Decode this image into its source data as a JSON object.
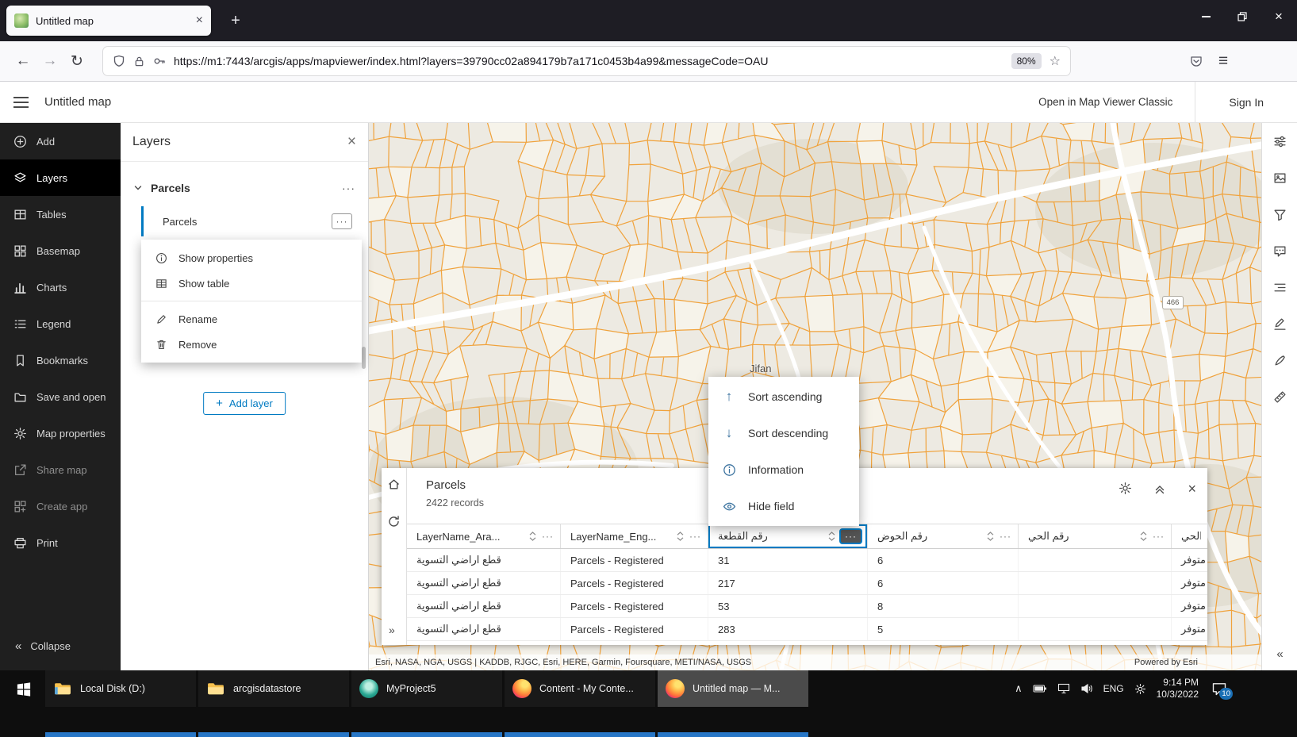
{
  "colors": {
    "accent": "#007ac2",
    "parcel_orange": "#f0a23b",
    "taskbar_indicator": "#2776c6"
  },
  "glyphs": {
    "close": "×",
    "plus": "+",
    "ellipsis": "···",
    "minimize": "–",
    "back": "←",
    "forward": "→",
    "reload": "↻",
    "star": "☆",
    "menu": "≡",
    "chevron_double_left": "«",
    "chevron_double_right": "»",
    "arrow_up": "↑",
    "arrow_down": "↓",
    "chevron_up": "∧"
  },
  "browser": {
    "tab_title": "Untitled map",
    "url": "https://m1:7443/arcgis/apps/mapviewer/index.html?layers=39790cc02a894179b7a171c0453b4a99&messageCode=OAU",
    "zoom_badge": "80%",
    "icon_names": [
      "shield-icon",
      "lock-icon",
      "key-icon",
      "star-icon",
      "pocket-icon",
      "menu-icon"
    ]
  },
  "app_header": {
    "title": "Untitled map",
    "open_classic": "Open in Map Viewer Classic",
    "sign_in": "Sign In"
  },
  "sidebar": {
    "items": [
      {
        "label": "Add",
        "icon": "add-icon"
      },
      {
        "label": "Layers",
        "icon": "layers-icon",
        "selected": true
      },
      {
        "label": "Tables",
        "icon": "tables-icon"
      },
      {
        "label": "Basemap",
        "icon": "basemap-icon"
      },
      {
        "label": "Charts",
        "icon": "charts-icon"
      },
      {
        "label": "Legend",
        "icon": "legend-icon"
      },
      {
        "label": "Bookmarks",
        "icon": "bookmark-icon"
      },
      {
        "label": "Save and open",
        "icon": "folder-icon"
      },
      {
        "label": "Map properties",
        "icon": "gear-icon"
      },
      {
        "label": "Share map",
        "icon": "share-icon",
        "disabled": true
      },
      {
        "label": "Create app",
        "icon": "create-app-icon",
        "disabled": true
      },
      {
        "label": "Print",
        "icon": "print-icon"
      }
    ],
    "collapse_label": "Collapse"
  },
  "layers_panel": {
    "title": "Layers",
    "group_name": "Parcels",
    "layer_name": "Parcels",
    "layer_menu": {
      "show_properties": "Show properties",
      "show_table": "Show table",
      "rename": "Rename",
      "remove": "Remove"
    },
    "add_layer_label": "Add layer"
  },
  "map": {
    "place_label": "Jifan",
    "route_shield": "466",
    "attribution": "Esri, NASA, NGA, USGS | KADDB, RJGC, Esri, HERE, Garmin, Foursquare, METI/NASA, USGS",
    "powered_by": "Powered by Esri"
  },
  "field_menu": {
    "sort_ascending": "Sort ascending",
    "sort_descending": "Sort descending",
    "information": "Information",
    "hide_field": "Hide field"
  },
  "table_panel": {
    "title": "Parcels",
    "records": "2422 records",
    "columns": [
      {
        "label": "LayerName_Ara..."
      },
      {
        "label": "LayerName_Eng..."
      },
      {
        "label": "رقم القطعة",
        "selected": true
      },
      {
        "label": "رقم الحوض"
      },
      {
        "label": "رقم الحي"
      },
      {
        "label": "الحي"
      }
    ],
    "rows": [
      [
        "قطع اراضي التسوية",
        "Parcels - Registered",
        "31",
        "6",
        "",
        "متوفر"
      ],
      [
        "قطع اراضي التسوية",
        "Parcels - Registered",
        "217",
        "6",
        "",
        "متوفر"
      ],
      [
        "قطع اراضي التسوية",
        "Parcels - Registered",
        "53",
        "8",
        "",
        "متوفر"
      ],
      [
        "قطع اراضي التسوية",
        "Parcels - Registered",
        "283",
        "5",
        "",
        "متوفر"
      ]
    ]
  },
  "right_toolbar": {
    "icons": [
      "map-properties",
      "basemap-style",
      "filter",
      "popups",
      "labels",
      "sketch",
      "edit",
      "measure"
    ]
  },
  "taskbar": {
    "apps": [
      {
        "label": "Local Disk (D:)",
        "icon": "file-explorer-icon"
      },
      {
        "label": "arcgisdatastore",
        "icon": "folder-icon"
      },
      {
        "label": "MyProject5",
        "icon": "arcgis-pro-icon"
      },
      {
        "label": "Content - My Conte...",
        "icon": "firefox-icon"
      },
      {
        "label": "Untitled map — M...",
        "icon": "firefox-icon",
        "active": true
      }
    ],
    "tray": {
      "language": "ENG",
      "time": "9:14 PM",
      "date": "10/3/2022",
      "notification_count": "10"
    }
  }
}
